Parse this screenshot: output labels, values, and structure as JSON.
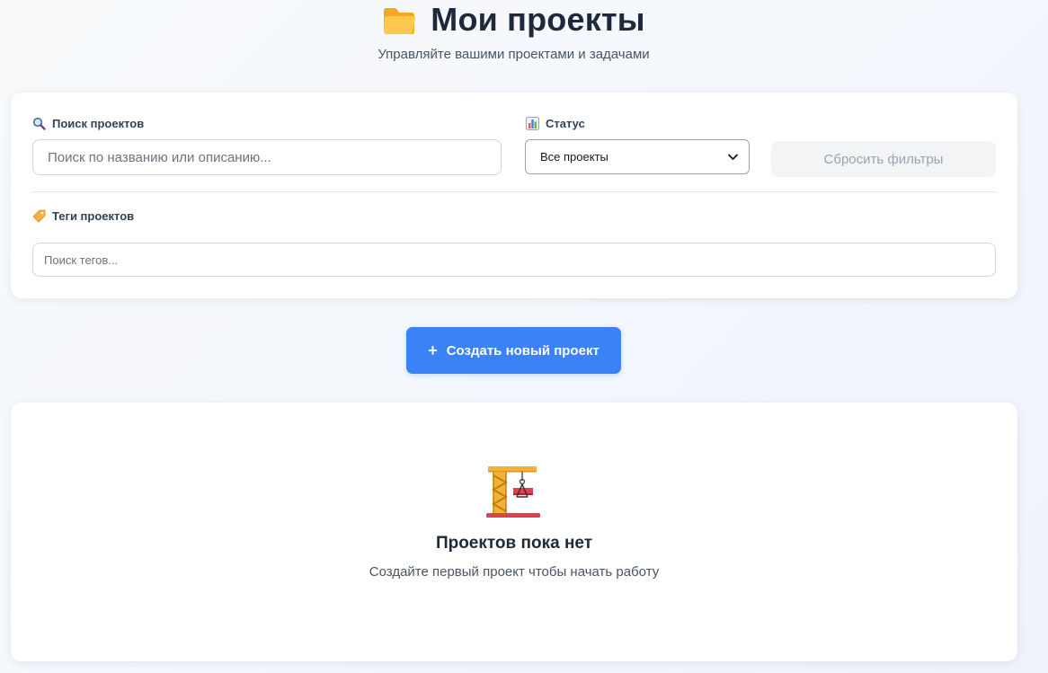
{
  "header": {
    "title": "Мои проекты",
    "subtitle": "Управляйте вашими проектами и задачами",
    "icon": "folder-icon"
  },
  "filters": {
    "search": {
      "label": "Поиск проектов",
      "icon": "magnifier-icon",
      "placeholder": "Поиск по названию или описанию...",
      "value": ""
    },
    "status": {
      "label": "Статус",
      "icon": "bar-chart-icon",
      "selected": "Все проекты"
    },
    "reset_label": "Сбросить фильтры",
    "tags": {
      "label": "Теги проектов",
      "icon": "tag-icon",
      "placeholder": "Поиск тегов...",
      "value": ""
    }
  },
  "create_button": {
    "icon": "+",
    "label": "Создать новый проект"
  },
  "empty_state": {
    "icon": "construction-crane-icon",
    "title": "Проектов пока нет",
    "text": "Создайте первый проект чтобы начать работу"
  },
  "colors": {
    "accent": "#3b82f6",
    "reset_bg": "#f3f4f6",
    "reset_text": "#9ca3af",
    "title": "#1e293b"
  }
}
